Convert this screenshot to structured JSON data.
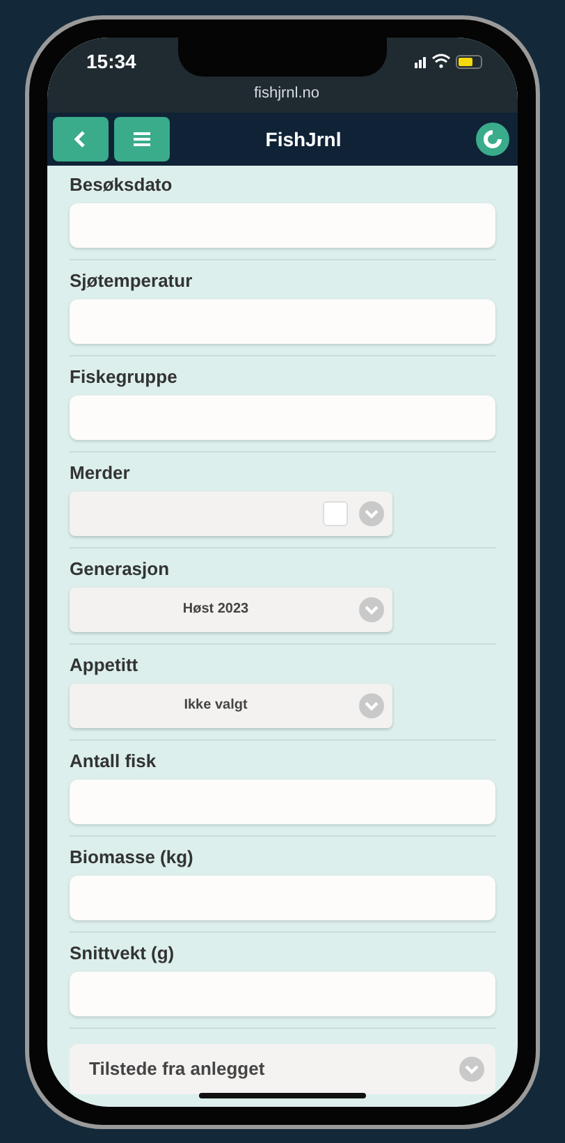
{
  "status_bar": {
    "time": "15:34",
    "url": "fishjrnl.no"
  },
  "header": {
    "title": "FishJrnl"
  },
  "fields": [
    {
      "kind": "text",
      "label": "Besøksdato"
    },
    {
      "kind": "text",
      "label": "Sjøtemperatur"
    },
    {
      "kind": "text",
      "label": "Fiskegruppe"
    },
    {
      "kind": "select",
      "label": "Merder",
      "checkbox": {
        "checked": false
      }
    },
    {
      "kind": "select",
      "label": "Generasjon",
      "value": "Høst 2023"
    },
    {
      "kind": "select",
      "label": "Appetitt",
      "value": "Ikke valgt"
    },
    {
      "kind": "text",
      "label": "Antall fisk"
    },
    {
      "kind": "text",
      "label": "Biomasse (kg)"
    },
    {
      "kind": "text",
      "label": "Snittvekt (g)"
    }
  ],
  "collapsible": {
    "label": "Tilstede fra anlegget",
    "expanded": false
  }
}
